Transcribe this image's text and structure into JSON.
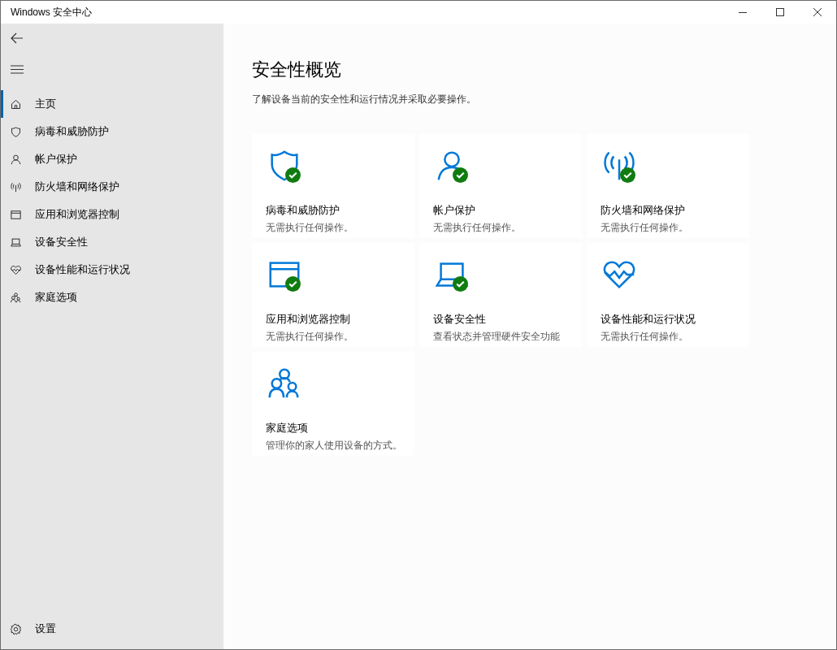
{
  "window": {
    "title": "Windows 安全中心"
  },
  "sidebar": {
    "items": [
      {
        "kind": "home",
        "label": "主页",
        "selected": true
      },
      {
        "kind": "shield",
        "label": "病毒和威胁防护",
        "selected": false
      },
      {
        "kind": "person",
        "label": "帐户保护",
        "selected": false
      },
      {
        "kind": "antenna",
        "label": "防火墙和网络保护",
        "selected": false
      },
      {
        "kind": "browser",
        "label": "应用和浏览器控制",
        "selected": false
      },
      {
        "kind": "laptop",
        "label": "设备安全性",
        "selected": false
      },
      {
        "kind": "heart",
        "label": "设备性能和运行状况",
        "selected": false
      },
      {
        "kind": "family",
        "label": "家庭选项",
        "selected": false
      }
    ],
    "settings": {
      "label": "设置"
    }
  },
  "page": {
    "title": "安全性概览",
    "subtitle": "了解设备当前的安全性和运行情况并采取必要操作。"
  },
  "cards": [
    {
      "kind": "shield",
      "title": "病毒和威胁防护",
      "description": "无需执行任何操作。",
      "ok": true
    },
    {
      "kind": "person",
      "title": "帐户保护",
      "description": "无需执行任何操作。",
      "ok": true
    },
    {
      "kind": "antenna",
      "title": "防火墙和网络保护",
      "description": "无需执行任何操作。",
      "ok": true
    },
    {
      "kind": "browser",
      "title": "应用和浏览器控制",
      "description": "无需执行任何操作。",
      "ok": true
    },
    {
      "kind": "laptop",
      "title": "设备安全性",
      "description": "查看状态并管理硬件安全功能",
      "ok": true
    },
    {
      "kind": "heart",
      "title": "设备性能和运行状况",
      "description": "无需执行任何操作。",
      "ok": false
    },
    {
      "kind": "family",
      "title": "家庭选项",
      "description": "管理你的家人使用设备的方式。",
      "ok": false
    }
  ]
}
